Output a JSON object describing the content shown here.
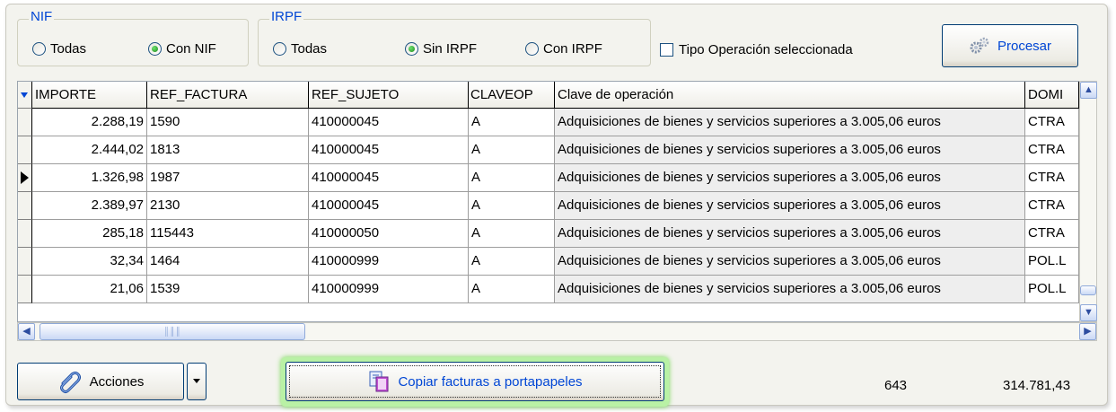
{
  "nif_group": {
    "title": "NIF",
    "options": [
      {
        "label": "Todas",
        "checked": false
      },
      {
        "label": "Con NIF",
        "checked": true
      }
    ]
  },
  "irpf_group": {
    "title": "IRPF",
    "options": [
      {
        "label": "Todas",
        "checked": false
      },
      {
        "label": "Sin IRPF",
        "checked": true
      },
      {
        "label": "Con IRPF",
        "checked": false
      }
    ]
  },
  "tipo_operacion": {
    "label": "Tipo Operación seleccionada",
    "checked": false
  },
  "procesar_label": "Procesar",
  "grid": {
    "columns": [
      "IMPORTE",
      "REF_FACTURA",
      "REF_SUJETO",
      "CLAVEOP",
      "Clave de operación",
      "DOMI"
    ],
    "rows": [
      [
        "2.288,19",
        "1590",
        "410000045",
        "A",
        "Adquisiciones de bienes y servicios superiores a  3.005,06 euros",
        "CTRA"
      ],
      [
        "2.444,02",
        "1813",
        "410000045",
        "A",
        "Adquisiciones de bienes y servicios superiores a  3.005,06 euros",
        "CTRA"
      ],
      [
        "1.326,98",
        "1987",
        "410000045",
        "A",
        "Adquisiciones de bienes y servicios superiores a  3.005,06 euros",
        "CTRA"
      ],
      [
        "2.389,97",
        "2130",
        "410000045",
        "A",
        "Adquisiciones de bienes y servicios superiores a  3.005,06 euros",
        "CTRA"
      ],
      [
        "285,18",
        "115443",
        "410000050",
        "A",
        "Adquisiciones de bienes y servicios superiores a  3.005,06 euros",
        "CTRA"
      ],
      [
        "32,34",
        "1464",
        "410000999",
        "A",
        "Adquisiciones de bienes y servicios superiores a  3.005,06 euros",
        "POL.L"
      ],
      [
        "21,06",
        "1539",
        "410000999",
        "A",
        "Adquisiciones de bienes y servicios superiores a  3.005,06 euros",
        "POL.L"
      ]
    ],
    "current_row": 2
  },
  "acciones_label": "Acciones",
  "copiar_label": "Copiar facturas a portapapeles",
  "footer": {
    "count": "643",
    "total": "314.781,43"
  }
}
